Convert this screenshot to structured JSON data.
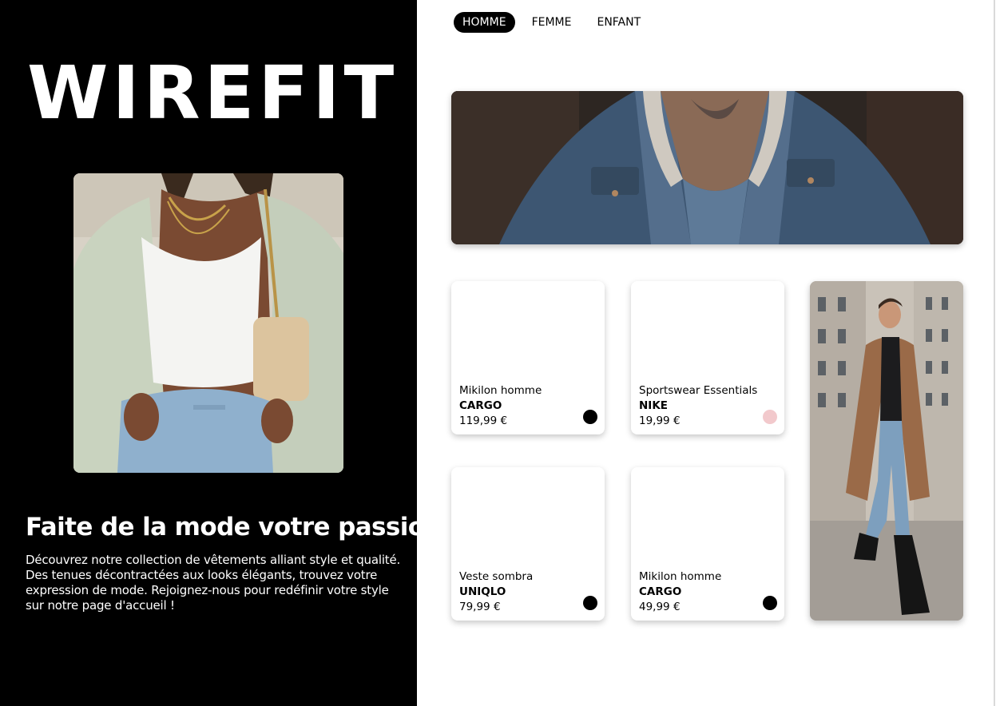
{
  "brand": {
    "logo_text": "WIREFIT"
  },
  "nav": {
    "items": [
      {
        "label": "HOMME",
        "active": true
      },
      {
        "label": "FEMME",
        "active": false
      },
      {
        "label": "ENFANT",
        "active": false
      }
    ]
  },
  "hero": {
    "headline": "Faite de la mode votre passion !",
    "description": "Découvrez notre collection de vêtements alliant style et qualité. Des tenues décontractées aux looks élégants, trouvez votre expression de mode. Rejoignez-nous pour redéfinir votre style sur notre page d'accueil !"
  },
  "products": [
    {
      "name": "Mikilon homme",
      "brand": "CARGO",
      "price": "119,99 €",
      "color": "#000000"
    },
    {
      "name": "Sportswear Essentials",
      "brand": "NIKE",
      "price": "19,99 €",
      "color": "#f2c9cc"
    },
    {
      "name": "Veste sombra",
      "brand": "UNIQLO",
      "price": "79,99 €",
      "color": "#000000"
    },
    {
      "name": "Mikilon homme",
      "brand": "CARGO",
      "price": "49,99 €",
      "color": "#000000"
    }
  ],
  "colors": {
    "panel_background": "#000000",
    "page_background": "#ffffff",
    "nav_active_background": "#000000"
  }
}
